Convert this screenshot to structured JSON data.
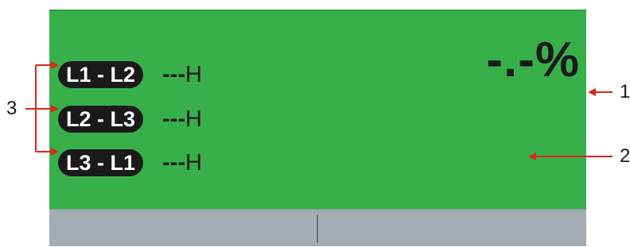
{
  "display": {
    "phases": [
      {
        "label": "L1 - L2",
        "value_dashes": "---",
        "value_unit": "H"
      },
      {
        "label": "L2 - L3",
        "value_dashes": "---",
        "value_unit": "H"
      },
      {
        "label": "L3 - L1",
        "value_dashes": "---",
        "value_unit": "H"
      }
    ],
    "percent_readout": "-.-%"
  },
  "callouts": {
    "c1": "1",
    "c2": "2",
    "c3": "3"
  },
  "colors": {
    "screen_bg": "#38b04a",
    "footer_bg": "#a4acb3",
    "badge_bg": "#1a1a1a",
    "arrow": "#e0261b"
  }
}
